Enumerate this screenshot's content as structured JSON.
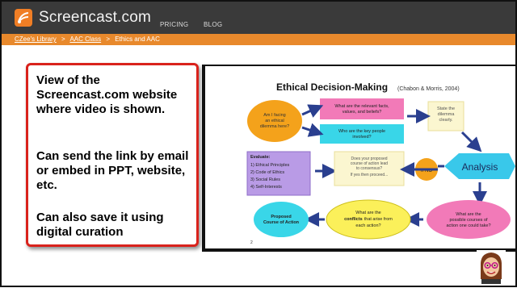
{
  "header": {
    "brand": "Screencast.com",
    "nav": [
      "PRICING",
      "BLOG"
    ],
    "logo_icon": "screencast-logo-icon",
    "colors": {
      "topbar": "#3a3a3a",
      "breadcrumb": "#e8892c",
      "accent": "#f07e25"
    }
  },
  "breadcrumb": {
    "items": [
      "CZee's Library",
      "AAC Class",
      "Ethics and AAC"
    ],
    "separator": ">"
  },
  "callout": {
    "lines": [
      "View of the Screencast.com website where video is shown.",
      "Can send the link by email or embed in PPT, website, etc.",
      "Can also save it using digital curation"
    ]
  },
  "slide": {
    "title": "Ethical Decision-Making",
    "citation": "(Chabon & Morris, 2004)",
    "nodes": {
      "q1": "Am I facing an ethical dilemma here?",
      "facts": "What are the relevant facts, values, and beliefs?",
      "people": "Who are the key people involved?",
      "state": "State the dilemma clearly.",
      "evaluate_title": "Evaluate:",
      "evaluate_items": [
        "1) Ethical Principles",
        "2) Code of Ethics",
        "3) Social Rules",
        "4) Self-Interests"
      ],
      "course_q": "Does your proposed course of action lead to consensus?",
      "course_if": "If yes then proceed...",
      "ifno": "If NO",
      "analysis": "Analysis",
      "proposed": "Proposed Course of Action",
      "conflicts": "What are the conflicts that arise from each action?",
      "outcomes": "What are the possible courses of action one could take?",
      "page": "2"
    }
  },
  "avatar": {
    "icon": "bitmoji-avatar-icon"
  }
}
